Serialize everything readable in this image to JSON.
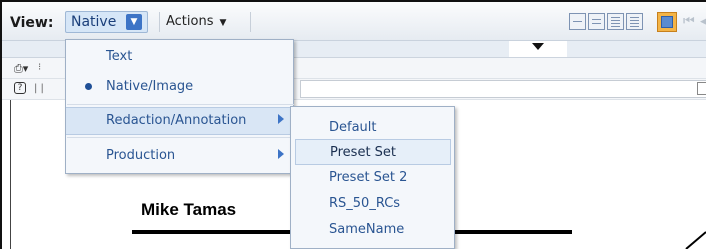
{
  "toolbar": {
    "view_label": "View:",
    "view_value": "Native",
    "actions_label": "Actions",
    "caret": "▼",
    "layout_buttons": [
      "layout-icon-1",
      "layout-icon-2",
      "layout-icon-3",
      "layout-icon-4"
    ],
    "save_icon": "save-icon",
    "nav_icons": [
      "first-page-icon",
      "prev-page-icon"
    ]
  },
  "view_menu": {
    "items": [
      {
        "label": "Text",
        "selected": false,
        "has_submenu": false
      },
      {
        "label": "Native/Image",
        "selected": true,
        "has_submenu": false
      },
      {
        "label": "Redaction/Annotation",
        "selected": false,
        "has_submenu": true
      },
      {
        "label": "Production",
        "selected": false,
        "has_submenu": true
      }
    ]
  },
  "submenu": {
    "items": [
      {
        "label": "Default"
      },
      {
        "label": "Preset Set"
      },
      {
        "label": "Preset Set 2"
      },
      {
        "label": "RS_50_RCs"
      },
      {
        "label": "SameName"
      }
    ],
    "highlighted": "Preset Set"
  },
  "document": {
    "name_text": "Mike Tamas"
  },
  "colors": {
    "accent": "#3d74c6",
    "menu_text": "#2a5592"
  }
}
